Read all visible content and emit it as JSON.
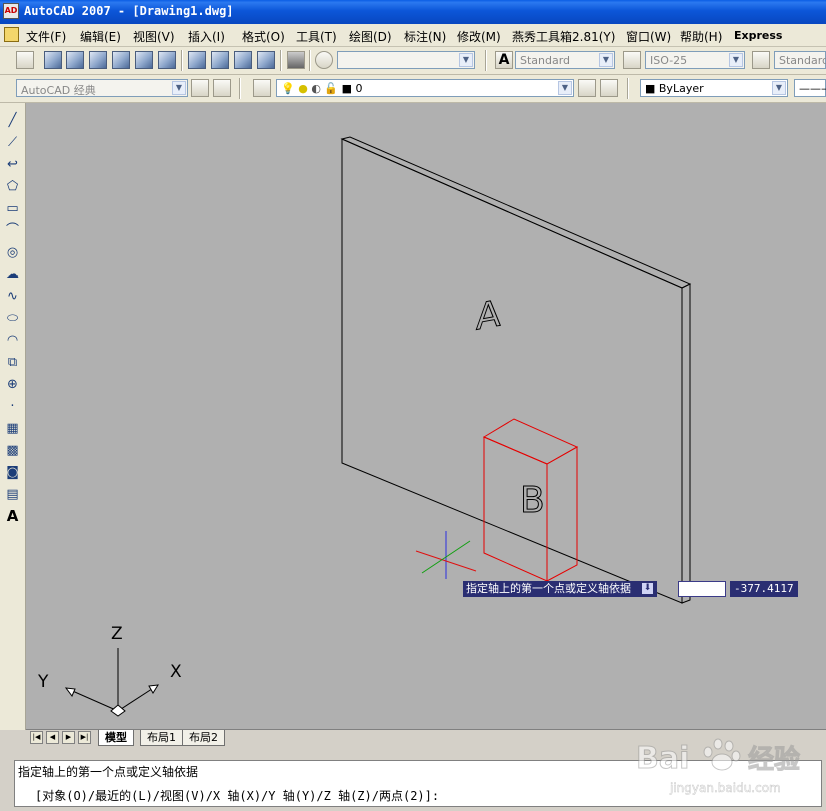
{
  "window": {
    "title": "AutoCAD 2007 - [Drawing1.dwg]",
    "app_icon": "AD"
  },
  "menu": [
    {
      "label": "文件(F)"
    },
    {
      "label": "编辑(E)"
    },
    {
      "label": "视图(V)"
    },
    {
      "label": "插入(I)"
    },
    {
      "label": "格式(O)"
    },
    {
      "label": "工具(T)"
    },
    {
      "label": "绘图(D)"
    },
    {
      "label": "标注(N)"
    },
    {
      "label": "修改(M)"
    },
    {
      "label": "燕秀工具箱2.81(Y)"
    },
    {
      "label": "窗口(W)"
    },
    {
      "label": "帮助(H)"
    },
    {
      "label": "Express"
    }
  ],
  "toolbar": {
    "text_style": "Standard",
    "dim_style": "ISO-25",
    "table_style": "Standard",
    "workspace": "AutoCAD 经典",
    "layer": "0",
    "color": "ByLayer"
  },
  "drawing": {
    "label_a": "A",
    "label_b": "B",
    "ucs": {
      "x": "X",
      "y": "Y",
      "z": "Z"
    },
    "dynamic_prompt": "指定轴上的第一个点或定义轴依据",
    "dynamic_input": "",
    "dynamic_value": "-377.4117",
    "colors": {
      "background": "#b0b0b0",
      "wire": "#000000",
      "selected": "#e60000",
      "dyn_bg": "#2a2e72"
    }
  },
  "tabs": [
    {
      "label": "模型"
    },
    {
      "label": "布局1"
    },
    {
      "label": "布局2"
    }
  ],
  "command": {
    "line1": "指定轴上的第一个点或定义轴依据",
    "line2": "[对象(O)/最近的(L)/视图(V)/X 轴(X)/Y 轴(Y)/Z 轴(Z)/两点(2)]:"
  },
  "watermark": {
    "brand": "Bai",
    "brand_cn": "经验",
    "url": "jingyan.baidu.com"
  }
}
